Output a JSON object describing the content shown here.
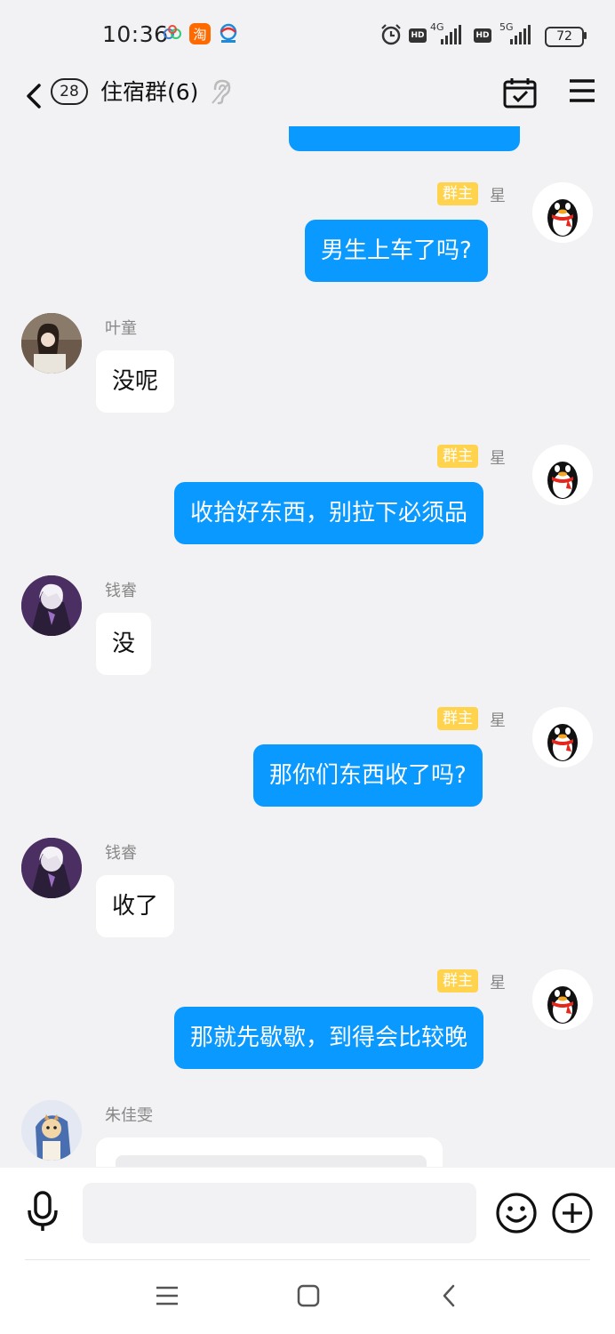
{
  "status_bar": {
    "time": "10:36",
    "net1": "4G",
    "net2": "5G",
    "hd": "HD",
    "battery": "72",
    "icons": [
      "cloud-icon",
      "taobao-icon",
      "china-mobile-icon",
      "alarm-icon"
    ]
  },
  "header": {
    "unread_count": "28",
    "title": "住宿群(6)",
    "icons": [
      "back-icon",
      "ear-icon",
      "calendar-check-icon",
      "menu-icon"
    ]
  },
  "messages": [
    {
      "side": "me",
      "text": "",
      "partial": true
    },
    {
      "side": "me",
      "role": "群主",
      "sender": "星",
      "text": "男生上车了吗?"
    },
    {
      "side": "other",
      "sender": "叶童",
      "text": "没呢"
    },
    {
      "side": "me",
      "role": "群主",
      "sender": "星",
      "text": "收拾好东西，别拉下必须品"
    },
    {
      "side": "other",
      "sender": "钱睿",
      "text": "没"
    },
    {
      "side": "me",
      "role": "群主",
      "sender": "星",
      "text": "那你们东西收了吗?"
    },
    {
      "side": "other",
      "sender": "钱睿",
      "text": "收了"
    },
    {
      "side": "me",
      "role": "群主",
      "sender": "星",
      "text": "那就先歇歇，到得会比较晚"
    },
    {
      "side": "other",
      "sender": "朱佳雯",
      "text": ""
    }
  ],
  "input_bar": {
    "placeholder": "",
    "icons": [
      "microphone-icon",
      "emoji-icon",
      "plus-icon"
    ]
  },
  "nav_bar": {
    "icons": [
      "recents-icon",
      "home-icon",
      "back-nav-icon"
    ]
  },
  "colors": {
    "my_bubble": "#0a99ff",
    "other_bubble": "#ffffff",
    "owner_badge": "#ffd34d",
    "background": "#f2f2f4"
  }
}
